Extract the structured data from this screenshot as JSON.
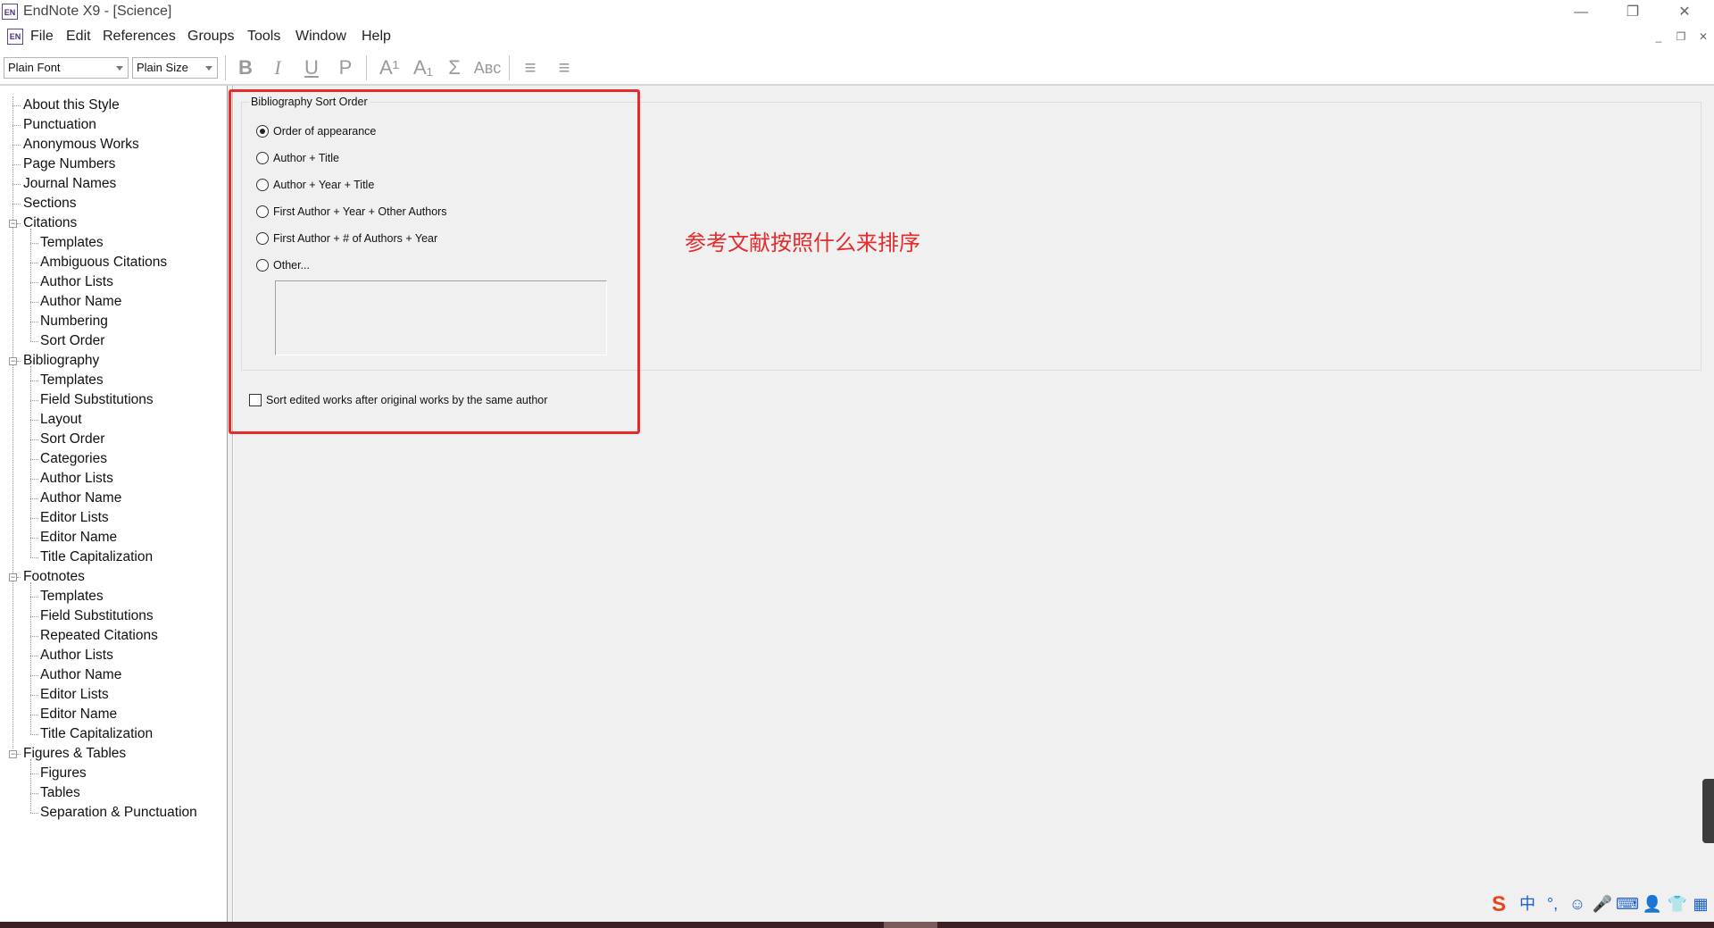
{
  "window": {
    "title": "EndNote X9 - [Science]",
    "app_icon": "EN",
    "controls": {
      "minimize": "—",
      "restore": "❐",
      "close": "✕"
    }
  },
  "menu": {
    "items": [
      "File",
      "Edit",
      "References",
      "Groups",
      "Tools",
      "Window",
      "Help"
    ],
    "mdi": {
      "minimize": "_",
      "restore": "❐",
      "close": "✕"
    }
  },
  "toolbar": {
    "font": "Plain Font",
    "size": "Plain Size",
    "bold": "B",
    "italic": "I",
    "underline": "U",
    "plain": "P",
    "superscript": "A¹",
    "subscript": "A₁",
    "symbol": "Σ",
    "small_caps": "Aʙᴄ",
    "align_left": "≡",
    "align_center": "≡"
  },
  "tree": {
    "top": [
      "About this Style",
      "Punctuation",
      "Anonymous Works",
      "Page Numbers",
      "Journal Names",
      "Sections"
    ],
    "groups": [
      {
        "label": "Citations",
        "children": [
          "Templates",
          "Ambiguous Citations",
          "Author Lists",
          "Author Name",
          "Numbering",
          "Sort Order"
        ]
      },
      {
        "label": "Bibliography",
        "children": [
          "Templates",
          "Field Substitutions",
          "Layout",
          "Sort Order",
          "Categories",
          "Author Lists",
          "Author Name",
          "Editor Lists",
          "Editor Name",
          "Title Capitalization"
        ]
      },
      {
        "label": "Footnotes",
        "children": [
          "Templates",
          "Field Substitutions",
          "Repeated Citations",
          "Author Lists",
          "Author Name",
          "Editor Lists",
          "Editor Name",
          "Title Capitalization"
        ]
      },
      {
        "label": "Figures & Tables",
        "children": [
          "Figures",
          "Tables",
          "Separation & Punctuation"
        ]
      }
    ],
    "selected": "Bibliography / Sort Order"
  },
  "panel": {
    "group_title": "Bibliography Sort Order",
    "options": [
      "Order of appearance",
      "Author + Title",
      "Author + Year + Title",
      "First Author + Year + Other Authors",
      "First Author + # of Authors + Year",
      "Other..."
    ],
    "selected_option": "Order of appearance",
    "other_value": "",
    "checkbox_label": "Sort edited works after original works by the same author",
    "checkbox_checked": false
  },
  "annotation": {
    "text": "参考文献按照什么来排序",
    "color": "#e52b2b"
  },
  "ime": {
    "logo": "S",
    "icons": [
      "中",
      "°,",
      "☺",
      "🎤",
      "⌨",
      "👤",
      "👕",
      "▦"
    ]
  },
  "colors": {
    "annotation_red": "#e52b2b",
    "panel_bg": "#f0f0f0",
    "ime_blue": "#1a5fc9",
    "ime_orange": "#e8431e"
  }
}
